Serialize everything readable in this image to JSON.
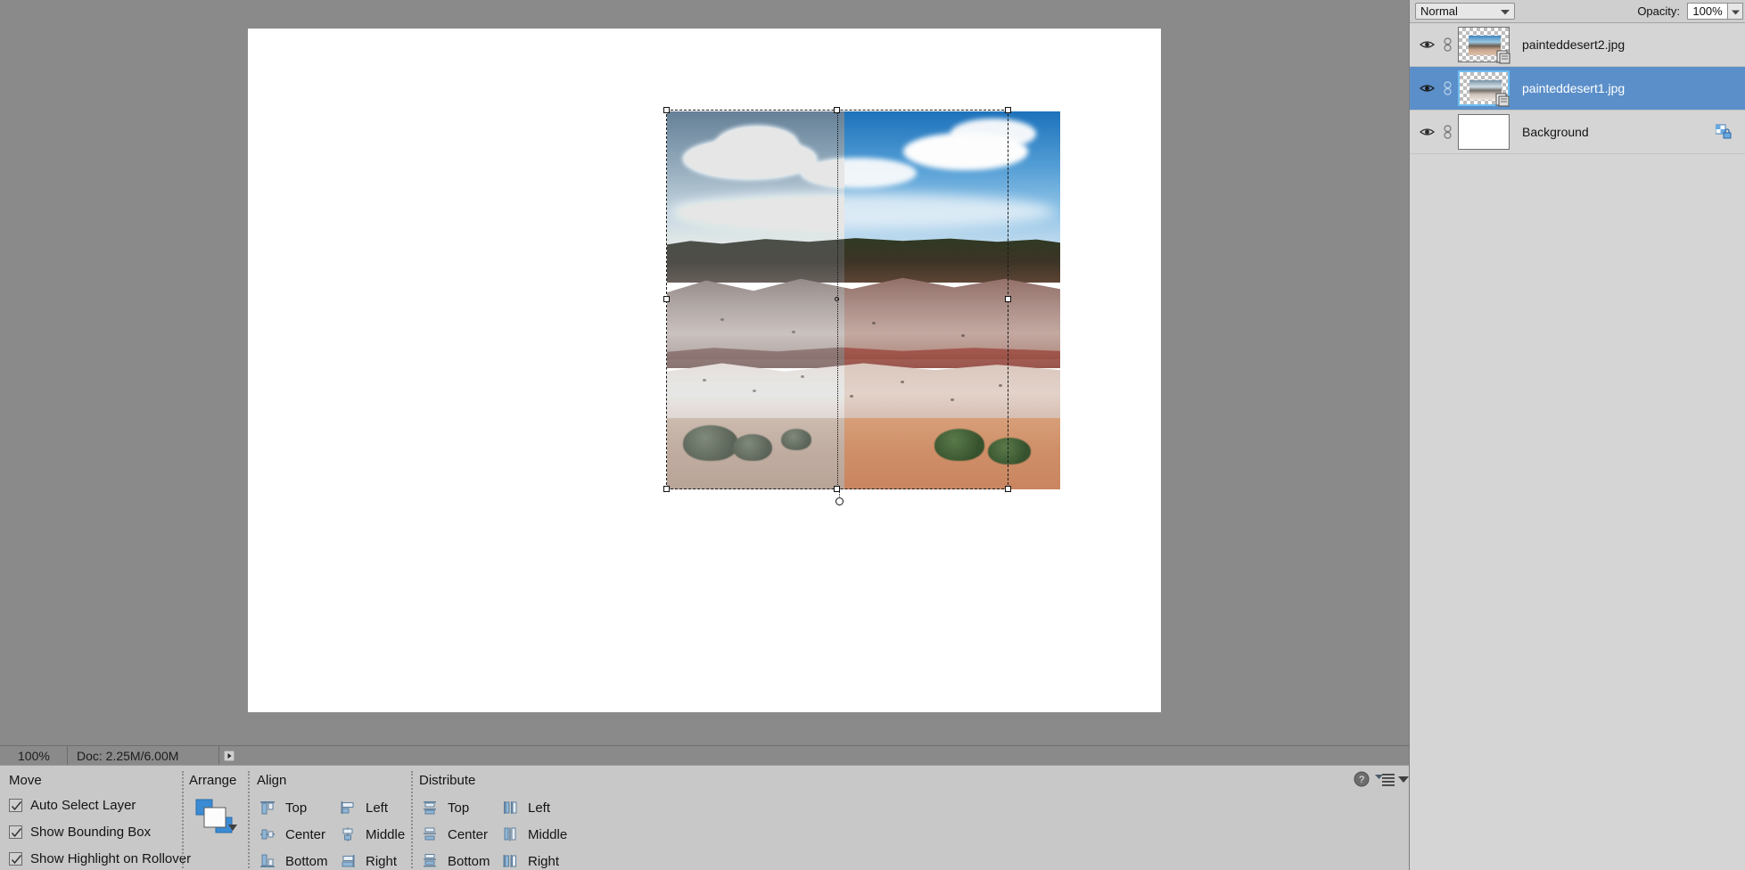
{
  "document": {
    "zoom_level": "100%",
    "doc_size": "Doc: 2.25M/6.00M",
    "status_arrow_icon": "triangle-right-icon"
  },
  "layers_panel": {
    "blend_mode": "Normal",
    "blend_mode_chevron_icon": "chevron-down-icon",
    "opacity_label": "Opacity:",
    "opacity_value": "100%",
    "opacity_stepper_icon": "chevron-down-icon",
    "rows": [
      {
        "name": "painteddesert2.jpg",
        "visible_icon": "eye-icon",
        "link_icon": "link-icon",
        "thumbnail_icon": "layer-thumbnail-desert",
        "mask_badge_icon": "smart-object-badge-icon",
        "selected": false,
        "locked": false
      },
      {
        "name": "painteddesert1.jpg",
        "visible_icon": "eye-icon",
        "link_icon": "link-icon",
        "thumbnail_icon": "layer-thumbnail-desert-pale",
        "mask_badge_icon": "smart-object-badge-icon",
        "selected": true,
        "locked": false
      },
      {
        "name": "Background",
        "visible_icon": "eye-icon",
        "link_icon": "link-icon",
        "thumbnail_icon": "layer-thumbnail-white",
        "mask_badge_icon": "",
        "selected": false,
        "locked": true,
        "lock_icon": "lock-transparency-icon"
      }
    ]
  },
  "options_panel": {
    "move": {
      "title": "Move",
      "options": [
        {
          "label": "Auto Select Layer",
          "checked": true
        },
        {
          "label": "Show Bounding Box",
          "checked": true
        },
        {
          "label": "Show Highlight on Rollover",
          "checked": true
        }
      ]
    },
    "arrange": {
      "title": "Arrange",
      "thumb_icon": "arrange-layers-icon",
      "chevron_icon": "chevron-down-icon"
    },
    "align": {
      "title": "Align",
      "items": [
        {
          "label": "Top",
          "icon": "align-top-edges-icon"
        },
        {
          "label": "Left",
          "icon": "align-left-edges-icon"
        },
        {
          "label": "Center",
          "icon": "align-vertical-centers-icon"
        },
        {
          "label": "Middle",
          "icon": "align-horizontal-centers-icon"
        },
        {
          "label": "Bottom",
          "icon": "align-bottom-edges-icon"
        },
        {
          "label": "Right",
          "icon": "align-right-edges-icon"
        }
      ]
    },
    "distribute": {
      "title": "Distribute",
      "items": [
        {
          "label": "Top",
          "icon": "distribute-top-edges-icon"
        },
        {
          "label": "Left",
          "icon": "distribute-left-edges-icon"
        },
        {
          "label": "Center",
          "icon": "distribute-vertical-centers-icon"
        },
        {
          "label": "Middle",
          "icon": "distribute-horizontal-centers-icon"
        },
        {
          "label": "Bottom",
          "icon": "distribute-bottom-edges-icon"
        },
        {
          "label": "Right",
          "icon": "distribute-right-edges-icon"
        }
      ]
    },
    "help_icon": "help-question-icon",
    "menu_icon": "panel-menu-icon",
    "collapse_icon": "chevron-down-icon"
  },
  "colors": {
    "selection_blue": "#5b8fc9",
    "panel_gray": "#c8c8c8",
    "workspace_gray": "#8a8a8a",
    "thumb_highlight": "#6ebdf0"
  }
}
